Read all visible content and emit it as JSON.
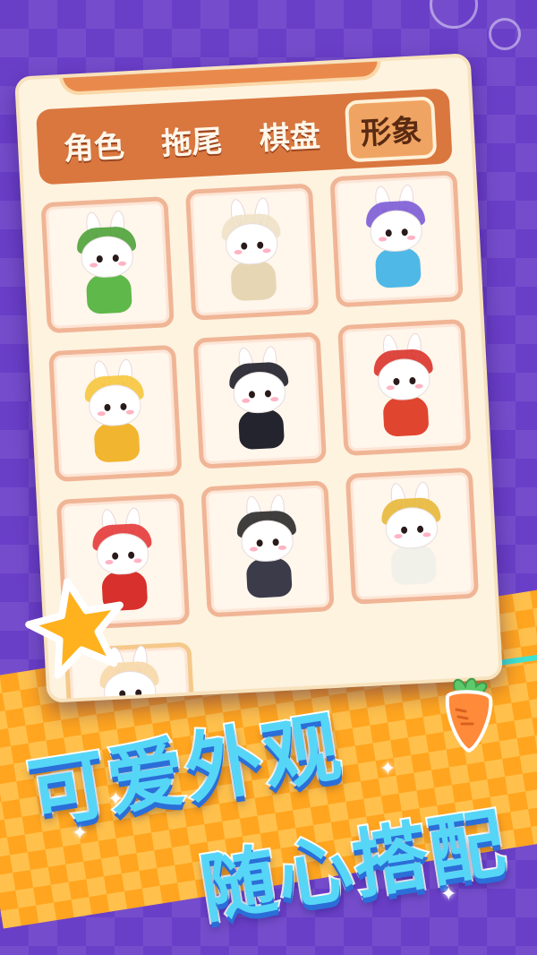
{
  "tabs": [
    {
      "label": "角色",
      "active": false
    },
    {
      "label": "拖尾",
      "active": false
    },
    {
      "label": "棋盘",
      "active": false
    },
    {
      "label": "形象",
      "active": true
    }
  ],
  "skins": [
    {
      "name": "cabbage-bunny",
      "hat": "#4ea23a",
      "body": "#5fb84a"
    },
    {
      "name": "bandage-bunny",
      "hat": "#efe2c8",
      "body": "#e7d6b4"
    },
    {
      "name": "monster-hood-bunny",
      "hat": "#7c5cd6",
      "body": "#4fb8e6"
    },
    {
      "name": "bee-bunny",
      "hat": "#f6c73d",
      "body": "#f1b52f"
    },
    {
      "name": "ninja-bunny",
      "hat": "#1f1f2a",
      "body": "#24242e"
    },
    {
      "name": "fortune-god-bunny",
      "hat": "#d9342b",
      "body": "#e0452f"
    },
    {
      "name": "lion-dance-bunny",
      "hat": "#e43a3a",
      "body": "#d8302c"
    },
    {
      "name": "pirate-bunny",
      "hat": "#2a2a2a",
      "body": "#3b3b4a"
    },
    {
      "name": "pharaoh-bunny",
      "hat": "#e8b83a",
      "body": "#f1f1ea"
    },
    {
      "name": "partial-skin",
      "hat": "#f7d8a8",
      "body": "#ffffff"
    }
  ],
  "headline": {
    "line1": "可爱外观",
    "line2": "随心搭配"
  },
  "colors": {
    "accent": "#d9773f",
    "panel": "#fdf3df",
    "headline": "#56d6f7"
  }
}
